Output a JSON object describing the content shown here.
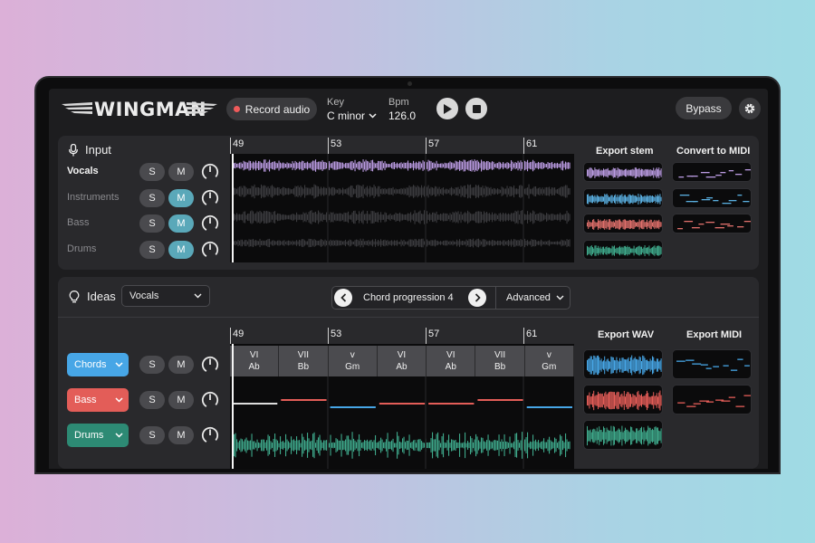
{
  "app": {
    "logo_text": "WINGMAN",
    "record_label": "Record audio",
    "key_label": "Key",
    "key_value": "C minor",
    "bpm_label": "Bpm",
    "bpm_value": "126.0",
    "bypass_label": "Bypass"
  },
  "input": {
    "title": "Input",
    "ruler": [
      "49",
      "53",
      "57",
      "61"
    ],
    "export_stem_label": "Export stem",
    "convert_midi_label": "Convert to MIDI",
    "tracks": [
      {
        "name": "Vocals",
        "solo": "S",
        "mute": "M",
        "mute_active": false,
        "color": "#b99ae0"
      },
      {
        "name": "Instruments",
        "solo": "S",
        "mute": "M",
        "mute_active": true,
        "color": "#5aafe0"
      },
      {
        "name": "Bass",
        "solo": "S",
        "mute": "M",
        "mute_active": true,
        "color": "#e0706c"
      },
      {
        "name": "Drums",
        "solo": "S",
        "mute": "M",
        "mute_active": true,
        "color": "#3ea88a"
      }
    ]
  },
  "ideas": {
    "title": "Ideas",
    "source_select": "Vocals",
    "progression_label": "Chord progression 4",
    "advanced_label": "Advanced",
    "ruler": [
      "49",
      "53",
      "57",
      "61"
    ],
    "export_wav_label": "Export WAV",
    "export_midi_label": "Export MIDI",
    "tracks": [
      {
        "name": "Chords",
        "solo": "S",
        "mute": "M"
      },
      {
        "name": "Bass",
        "solo": "S",
        "mute": "M"
      },
      {
        "name": "Drums",
        "solo": "S",
        "mute": "M"
      }
    ],
    "chords": [
      {
        "numeral": "VI",
        "name": "Ab"
      },
      {
        "numeral": "VII",
        "name": "Bb"
      },
      {
        "numeral": "v",
        "name": "Gm"
      },
      {
        "numeral": "VI",
        "name": "Ab"
      },
      {
        "numeral": "VI",
        "name": "Ab"
      },
      {
        "numeral": "VII",
        "name": "Bb"
      },
      {
        "numeral": "v",
        "name": "Gm"
      }
    ]
  },
  "colors": {
    "accent_teal": "#5aa8b9",
    "chords_blue": "#47a6e6",
    "bass_red": "#e35d58",
    "drums_green": "#2d8a74",
    "vocals_purple": "#b99ae0"
  },
  "icons": [
    "mic-icon",
    "lightbulb-icon",
    "play-icon",
    "stop-icon",
    "gear-icon",
    "chevron-down-icon",
    "chevron-left-icon",
    "chevron-right-icon",
    "knob-icon"
  ]
}
